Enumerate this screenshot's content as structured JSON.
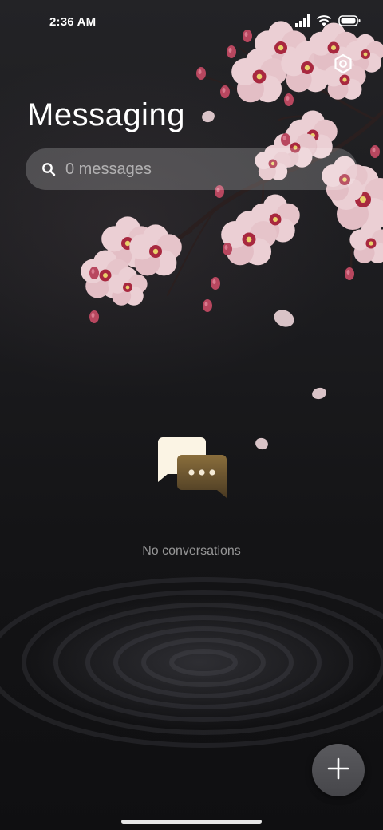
{
  "status_bar": {
    "time": "2:36 AM",
    "icons": [
      "signal-icon",
      "wifi-icon",
      "battery-icon"
    ]
  },
  "header": {
    "title": "Messaging",
    "settings_icon": "settings-icon"
  },
  "search": {
    "placeholder": "0 messages",
    "icon": "search-icon"
  },
  "empty_state": {
    "icon": "conversations-icon",
    "text": "No conversations"
  },
  "fab": {
    "icon": "plus-icon"
  },
  "colors": {
    "background_top": "#232326",
    "background_bottom": "#0f0f11",
    "search_bar": "rgba(255,255,255,0.20)",
    "fab": "#505054",
    "blossom": "#e9c9cf",
    "bud": "#b8475f"
  }
}
